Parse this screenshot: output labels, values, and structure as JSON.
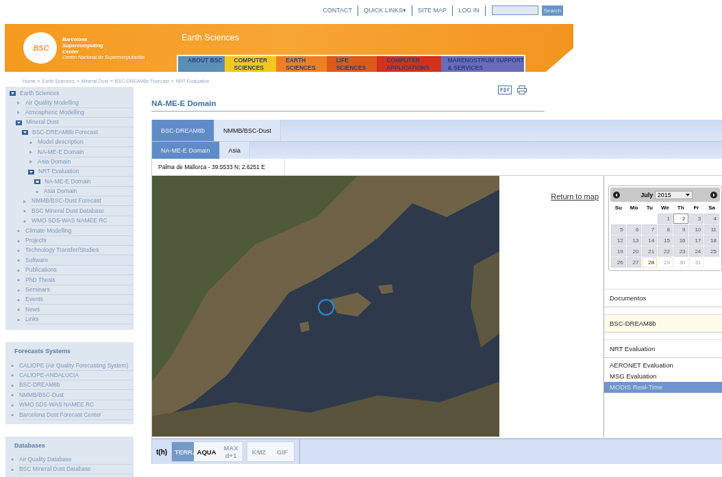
{
  "top_links": [
    {
      "label": "CONTACT"
    },
    {
      "label": "QUICK LINKS",
      "icon": "▾"
    },
    {
      "label": "SITE MAP"
    },
    {
      "label": "LOG IN"
    }
  ],
  "search": {
    "button": "Search"
  },
  "banner": {
    "logo_text": "BSC",
    "org_lines": [
      "Barcelona",
      "Supercomputing",
      "Center"
    ],
    "org_subtitle": "Centro Nacional de Supercomputación",
    "section_title": "Earth Sciences"
  },
  "nav": [
    {
      "lines": [
        "ABOUT BSC"
      ],
      "color": "#5b8fb8"
    },
    {
      "lines": [
        "COMPUTER",
        "SCIENCES"
      ],
      "color": "#f2c81e"
    },
    {
      "lines": [
        "EARTH",
        "SCIENCES"
      ],
      "color": "#ee8024"
    },
    {
      "lines": [
        "LIFE",
        "SCIENCES"
      ],
      "color": "#dc5a1c"
    },
    {
      "lines": [
        "COMPUTER",
        "APPLICATIONS"
      ],
      "color": "#d2321c"
    },
    {
      "lines": [
        "MARENOSTRUM SUPPORT",
        "& SERVICES"
      ],
      "color": "#6a6cba"
    }
  ],
  "breadcrumb": [
    {
      "label": "Home",
      "separator": "»"
    },
    {
      "label": "Earth Sciences",
      "separator": "»"
    },
    {
      "label": "Mineral Dust",
      "separator": "»"
    },
    {
      "label": "BSC-DREAM8b Forecast",
      "separator": "»"
    },
    {
      "label": "NRT Evaluation"
    }
  ],
  "sidebar": {
    "tree": [
      {
        "label": "Earth Sciences",
        "kind": "open",
        "children": [
          {
            "label": "Air Quality Modelling",
            "kind": "closed"
          },
          {
            "label": "Atmospheric Modelling",
            "kind": "closed"
          },
          {
            "label": "Mineral Dust",
            "kind": "open",
            "children": [
              {
                "label": "BSC-DREAM8b Forecast",
                "kind": "open",
                "children": [
                  {
                    "label": "Model description",
                    "kind": "leaf"
                  },
                  {
                    "label": "NA-ME-E Domain",
                    "kind": "closed"
                  },
                  {
                    "label": "Asia Domain",
                    "kind": "closed"
                  },
                  {
                    "label": "NRT Evaluation",
                    "kind": "open",
                    "children": [
                      {
                        "label": "NA-ME-E Domain",
                        "kind": "current"
                      },
                      {
                        "label": "Asia Domain",
                        "kind": "leaf"
                      }
                    ]
                  }
                ]
              },
              {
                "label": "NMMB/BSC-Dust Forecast",
                "kind": "closed"
              },
              {
                "label": "BSC Mineral Dust Database",
                "kind": "leaf"
              },
              {
                "label": "WMO SDS-WAS NAMEE RC",
                "kind": "leaf"
              }
            ]
          },
          {
            "label": "Climate Modelling",
            "kind": "leaf"
          },
          {
            "label": "Projects",
            "kind": "leaf"
          },
          {
            "label": "Technology Transfer/Studies",
            "kind": "leaf"
          },
          {
            "label": "Software",
            "kind": "leaf"
          },
          {
            "label": "Publications",
            "kind": "leaf"
          },
          {
            "label": "PhD Thesis",
            "kind": "leaf"
          },
          {
            "label": "Seminars",
            "kind": "leaf"
          },
          {
            "label": "Events",
            "kind": "leaf"
          },
          {
            "label": "News",
            "kind": "leaf"
          },
          {
            "label": "Links",
            "kind": "leaf"
          }
        ]
      }
    ],
    "boxes": [
      {
        "title": "Forecasts Systems",
        "items": [
          "CALIOPE (Air Quality Forecasting System)",
          "CALIOPE-ANDALUCIA",
          "BSC-DREAM8b",
          "NMMB/BSC-Dust",
          "WMO SDS-WAS NAMEE RC",
          "Barcelona Dust Forecast Center"
        ]
      },
      {
        "title": "Databases",
        "items": [
          "Air Quality Database",
          "BSC Mineral Dust Database"
        ]
      }
    ]
  },
  "page_title": "NA-ME-E Domain",
  "model_tabs": [
    {
      "label": "BSC-DREAM8b",
      "selected": true
    },
    {
      "label": "NMMB/BSC-Dust",
      "selected": false
    }
  ],
  "domain_tabs": [
    {
      "label": "NA-ME-E Domain",
      "selected": true
    },
    {
      "label": "Asia",
      "selected": false
    }
  ],
  "location": "Palma de Mallorca - 39.5533 N; 2.6251 E",
  "return_link": "Return to map",
  "calendar": {
    "month": "July",
    "year": "2015",
    "weekdays": [
      "Su",
      "Mo",
      "Tu",
      "We",
      "Th",
      "Fr",
      "Sa"
    ],
    "weeks": [
      [
        {
          "kind": "blank"
        },
        {
          "kind": "blank"
        },
        {
          "kind": "blank"
        },
        {
          "day": "1",
          "kind": "available"
        },
        {
          "day": "2",
          "kind": "today"
        },
        {
          "day": "3",
          "kind": "available"
        },
        {
          "day": "4",
          "kind": "available"
        }
      ],
      [
        {
          "day": "5",
          "kind": "available"
        },
        {
          "day": "6",
          "kind": "available"
        },
        {
          "day": "7",
          "kind": "available"
        },
        {
          "day": "8",
          "kind": "available"
        },
        {
          "day": "9",
          "kind": "available"
        },
        {
          "day": "10",
          "kind": "available"
        },
        {
          "day": "11",
          "kind": "available"
        }
      ],
      [
        {
          "day": "12",
          "kind": "available"
        },
        {
          "day": "13",
          "kind": "available"
        },
        {
          "day": "14",
          "kind": "available"
        },
        {
          "day": "15",
          "kind": "available"
        },
        {
          "day": "16",
          "kind": "available"
        },
        {
          "day": "17",
          "kind": "available"
        },
        {
          "day": "18",
          "kind": "available"
        }
      ],
      [
        {
          "day": "19",
          "kind": "available"
        },
        {
          "day": "20",
          "kind": "available"
        },
        {
          "day": "21",
          "kind": "available"
        },
        {
          "day": "22",
          "kind": "available"
        },
        {
          "day": "23",
          "kind": "available"
        },
        {
          "day": "24",
          "kind": "available"
        },
        {
          "day": "25",
          "kind": "available"
        }
      ],
      [
        {
          "day": "26",
          "kind": "available"
        },
        {
          "day": "27",
          "kind": "available"
        },
        {
          "day": "28",
          "kind": "selected"
        },
        {
          "day": "29",
          "kind": "disabled"
        },
        {
          "day": "30",
          "kind": "disabled"
        },
        {
          "day": "31",
          "kind": "disabled"
        },
        {
          "kind": "blank"
        }
      ]
    ]
  },
  "side_menu": [
    {
      "label": "Documentos",
      "highlighted": false
    },
    {
      "label": "BSC-DREAM8b",
      "highlighted": true
    },
    {
      "label": "NRT Evaluation",
      "highlighted": false
    }
  ],
  "evaluations": [
    {
      "label": "AERONET Evaluation",
      "selected": false
    },
    {
      "label": "MSG Evaluation",
      "selected": false
    },
    {
      "label": "MODIS Real-Time",
      "selected": true
    }
  ],
  "time_label": "t(h)",
  "satellite_buttons": [
    {
      "label": "TERR.",
      "selected": true,
      "disabled": false
    },
    {
      "label": "AQUA",
      "selected": false,
      "disabled": false
    },
    {
      "label": "MAX d+1",
      "selected": false,
      "disabled": true
    }
  ],
  "export_buttons": [
    {
      "label": "KMZ",
      "disabled": true
    },
    {
      "label": "GIF",
      "disabled": true
    }
  ]
}
